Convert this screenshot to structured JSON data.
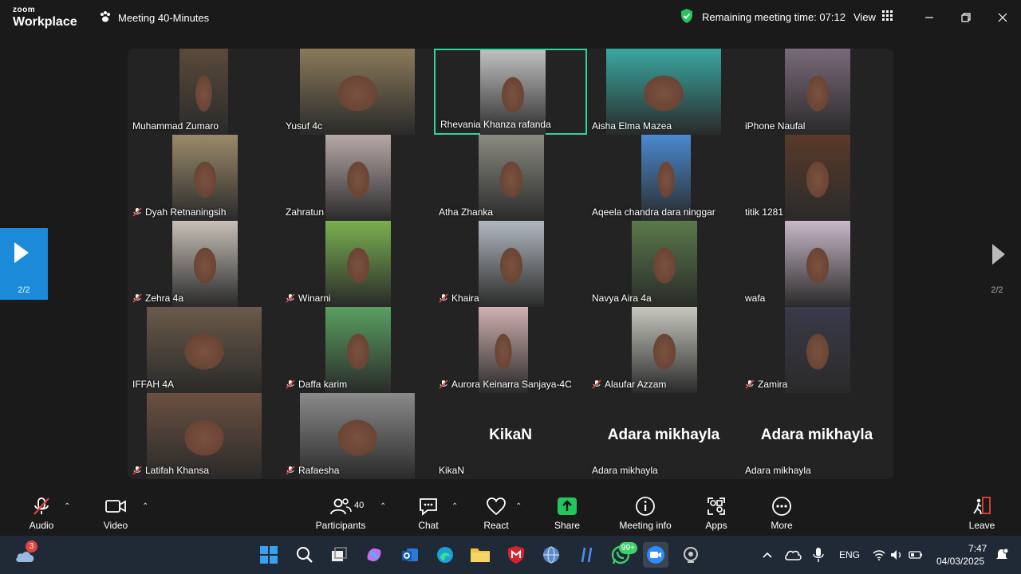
{
  "app": {
    "brand_top": "zoom",
    "brand_bottom": "Workplace"
  },
  "header": {
    "meeting_title": "Meeting 40-Minutes",
    "remaining_time": "Remaining meeting time: 07:12",
    "view_label": "View"
  },
  "colors": {
    "accent_green": "#2dd4a0",
    "nav_blue": "#1b8ad8",
    "mute_red": "#e0443e",
    "shield_green": "#23c55e"
  },
  "gallery": {
    "page_indicator_left": "2/2",
    "page_indicator_right": "2/2",
    "tiles": [
      {
        "name": "Muhammad Zumaro",
        "muted": false
      },
      {
        "name": "Yusuf 4c",
        "muted": false
      },
      {
        "name": "Rhevania Khanza rafanda",
        "muted": false,
        "active": true
      },
      {
        "name": "Aisha Elma Mazea",
        "muted": false
      },
      {
        "name": "iPhone Naufal",
        "muted": false
      },
      {
        "name": "Dyah Retnaningsih",
        "muted": true
      },
      {
        "name": "Zahratun",
        "muted": false
      },
      {
        "name": "Atha Zhanka",
        "muted": false
      },
      {
        "name": "Aqeela chandra dara ninggar",
        "muted": false
      },
      {
        "name": "titik 1281",
        "muted": false
      },
      {
        "name": "Zehra 4a",
        "muted": true
      },
      {
        "name": "Winarni",
        "muted": true
      },
      {
        "name": "Khaira",
        "muted": true
      },
      {
        "name": "Navya Aira 4a",
        "muted": false
      },
      {
        "name": "wafa",
        "muted": false
      },
      {
        "name": "IFFAH 4A",
        "muted": false
      },
      {
        "name": "Daffa karim",
        "muted": true
      },
      {
        "name": "Aurora Keinarra Sanjaya-4C",
        "muted": true
      },
      {
        "name": "Alaufar Azzam",
        "muted": true
      },
      {
        "name": "Zamira",
        "muted": true
      },
      {
        "name": "Latifah Khansa",
        "muted": true
      },
      {
        "name": "Rafaesha",
        "muted": true
      },
      {
        "name": "KikaN",
        "muted": false,
        "no_video": true,
        "big_name": "KikaN"
      },
      {
        "name": "Adara mikhayla",
        "muted": false,
        "no_video": true,
        "big_name": "Adara mikhayla"
      },
      {
        "name": "Adara mikhayla",
        "muted": false,
        "no_video": true,
        "big_name": "Adara mikhayla"
      }
    ]
  },
  "toolbar": {
    "audio": "Audio",
    "video": "Video",
    "participants": "Participants",
    "participants_count": "40",
    "chat": "Chat",
    "react": "React",
    "share": "Share",
    "meeting_info": "Meeting info",
    "apps": "Apps",
    "more": "More",
    "leave": "Leave"
  },
  "taskbar": {
    "weather_badge": "3",
    "whatsapp_badge": "99+",
    "language": "ENG",
    "time": "7:47",
    "date": "04/03/2025"
  }
}
